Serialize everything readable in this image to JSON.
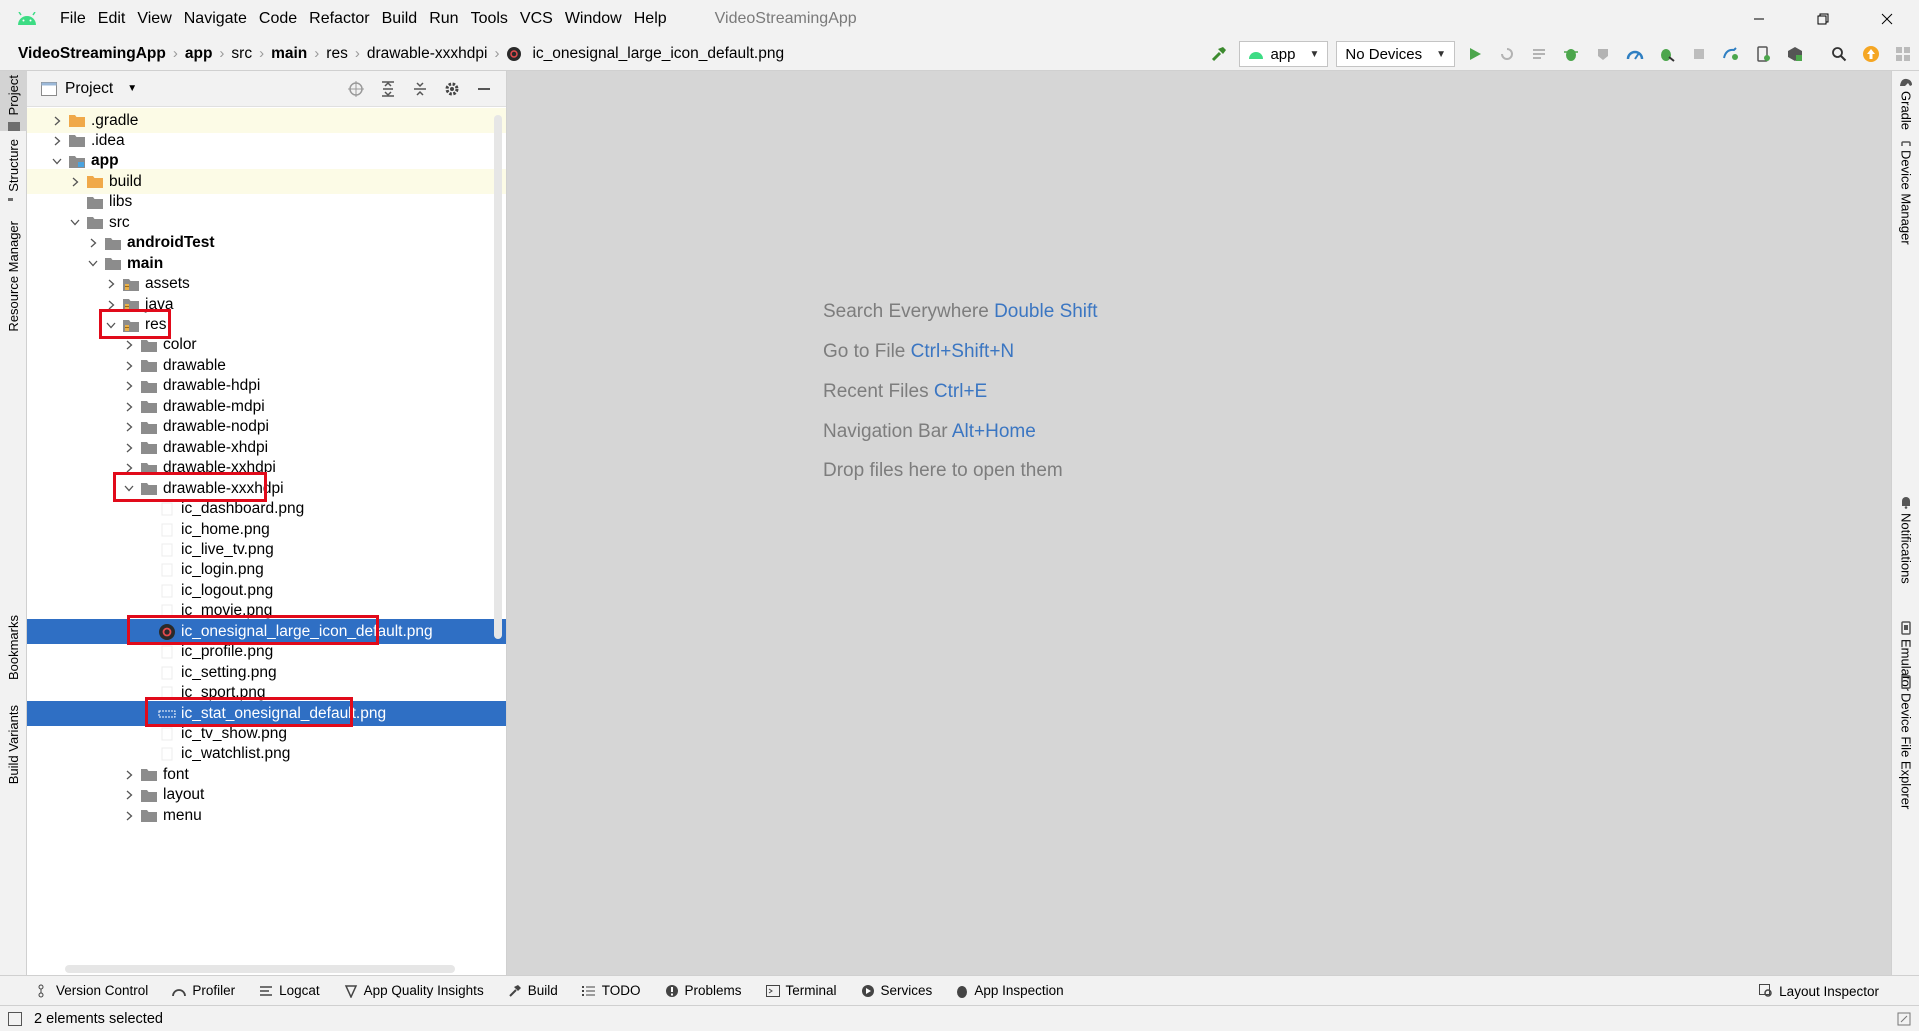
{
  "menu": [
    "File",
    "Edit",
    "View",
    "Navigate",
    "Code",
    "Refactor",
    "Build",
    "Run",
    "Tools",
    "VCS",
    "Window",
    "Help"
  ],
  "app_title": "VideoStreamingApp",
  "breadcrumbs": [
    "VideoStreamingApp",
    "app",
    "src",
    "main",
    "res",
    "drawable-xxxhdpi",
    "ic_onesignal_large_icon_default.png"
  ],
  "toolbar": {
    "run_config": "app",
    "device": "No Devices"
  },
  "left_tabs": [
    "Project",
    "Structure",
    "Resource Manager",
    "Bookmarks",
    "Build Variants"
  ],
  "right_tabs": [
    "Gradle",
    "Device Manager",
    "Notifications",
    "Emulator",
    "Device File Explorer"
  ],
  "project_panel": {
    "title": "Project"
  },
  "tree": [
    {
      "label": ".gradle",
      "chev": "right",
      "icon": "folder-orange",
      "bold": false,
      "hl": true
    },
    {
      "label": ".idea",
      "chev": "right",
      "icon": "folder-grey",
      "bold": false
    },
    {
      "label": "app",
      "chev": "down",
      "icon": "folder-module",
      "bold": true
    },
    {
      "label": "build",
      "chev": "right",
      "icon": "folder-orange",
      "bold": false,
      "hl": true
    },
    {
      "label": "libs",
      "chev": "",
      "icon": "folder-grey",
      "bold": false
    },
    {
      "label": "src",
      "chev": "down",
      "icon": "folder-grey",
      "bold": false
    },
    {
      "label": "androidTest",
      "chev": "right",
      "icon": "folder-grey",
      "bold": true
    },
    {
      "label": "main",
      "chev": "down",
      "icon": "folder-grey",
      "bold": true
    },
    {
      "label": "assets",
      "chev": "right",
      "icon": "folder-res",
      "bold": false
    },
    {
      "label": "java",
      "chev": "right",
      "icon": "folder-res",
      "bold": false
    },
    {
      "label": "res",
      "chev": "down",
      "icon": "folder-res",
      "bold": false
    },
    {
      "label": "color",
      "chev": "right",
      "icon": "folder-grey",
      "bold": false
    },
    {
      "label": "drawable",
      "chev": "right",
      "icon": "folder-grey",
      "bold": false
    },
    {
      "label": "drawable-hdpi",
      "chev": "right",
      "icon": "folder-grey",
      "bold": false
    },
    {
      "label": "drawable-mdpi",
      "chev": "right",
      "icon": "folder-grey",
      "bold": false
    },
    {
      "label": "drawable-nodpi",
      "chev": "right",
      "icon": "folder-grey",
      "bold": false
    },
    {
      "label": "drawable-xhdpi",
      "chev": "right",
      "icon": "folder-grey",
      "bold": false
    },
    {
      "label": "drawable-xxhdpi",
      "chev": "right",
      "icon": "folder-grey",
      "bold": false
    },
    {
      "label": "drawable-xxxhdpi",
      "chev": "down",
      "icon": "folder-grey",
      "bold": false
    },
    {
      "label": "ic_dashboard.png",
      "chev": "",
      "icon": "png-blank",
      "bold": false
    },
    {
      "label": "ic_home.png",
      "chev": "",
      "icon": "png-blank",
      "bold": false
    },
    {
      "label": "ic_live_tv.png",
      "chev": "",
      "icon": "png-blank",
      "bold": false
    },
    {
      "label": "ic_login.png",
      "chev": "",
      "icon": "png-blank",
      "bold": false
    },
    {
      "label": "ic_logout.png",
      "chev": "",
      "icon": "png-blank",
      "bold": false
    },
    {
      "label": "ic_movie.png",
      "chev": "",
      "icon": "png-blank",
      "bold": false
    },
    {
      "label": "ic_onesignal_large_icon_default.png",
      "chev": "",
      "icon": "png-onesignal",
      "bold": false,
      "sel": true
    },
    {
      "label": "ic_profile.png",
      "chev": "",
      "icon": "png-blank",
      "bold": false
    },
    {
      "label": "ic_setting.png",
      "chev": "",
      "icon": "png-blank",
      "bold": false
    },
    {
      "label": "ic_sport.png",
      "chev": "",
      "icon": "png-blank",
      "bold": false
    },
    {
      "label": "ic_stat_onesignal_default.png",
      "chev": "",
      "icon": "png-stat",
      "bold": false,
      "sel": true
    },
    {
      "label": "ic_tv_show.png",
      "chev": "",
      "icon": "png-blank",
      "bold": false
    },
    {
      "label": "ic_watchlist.png",
      "chev": "",
      "icon": "png-blank",
      "bold": false
    },
    {
      "label": "font",
      "chev": "right",
      "icon": "folder-grey",
      "bold": false
    },
    {
      "label": "layout",
      "chev": "right",
      "icon": "folder-grey",
      "bold": false
    },
    {
      "label": "menu",
      "chev": "right",
      "icon": "folder-grey",
      "bold": false
    }
  ],
  "editor_hints": [
    {
      "text": "Search Everywhere",
      "key": "Double Shift"
    },
    {
      "text": "Go to File",
      "key": "Ctrl+Shift+N"
    },
    {
      "text": "Recent Files",
      "key": "Ctrl+E"
    },
    {
      "text": "Navigation Bar",
      "key": "Alt+Home"
    },
    {
      "text": "Drop files here to open them",
      "key": ""
    }
  ],
  "bottom_tabs": [
    "Version Control",
    "Profiler",
    "Logcat",
    "App Quality Insights",
    "Build",
    "TODO",
    "Problems",
    "Terminal",
    "Services",
    "App Inspection"
  ],
  "bottom_right_tab": "Layout Inspector",
  "status": {
    "text": "2 elements selected"
  },
  "colors": {
    "selection": "#2f6fc4",
    "annotation_box": "#e10a1a",
    "hint_key": "#3b76c2",
    "editor_bg": "#d6d6d6"
  }
}
